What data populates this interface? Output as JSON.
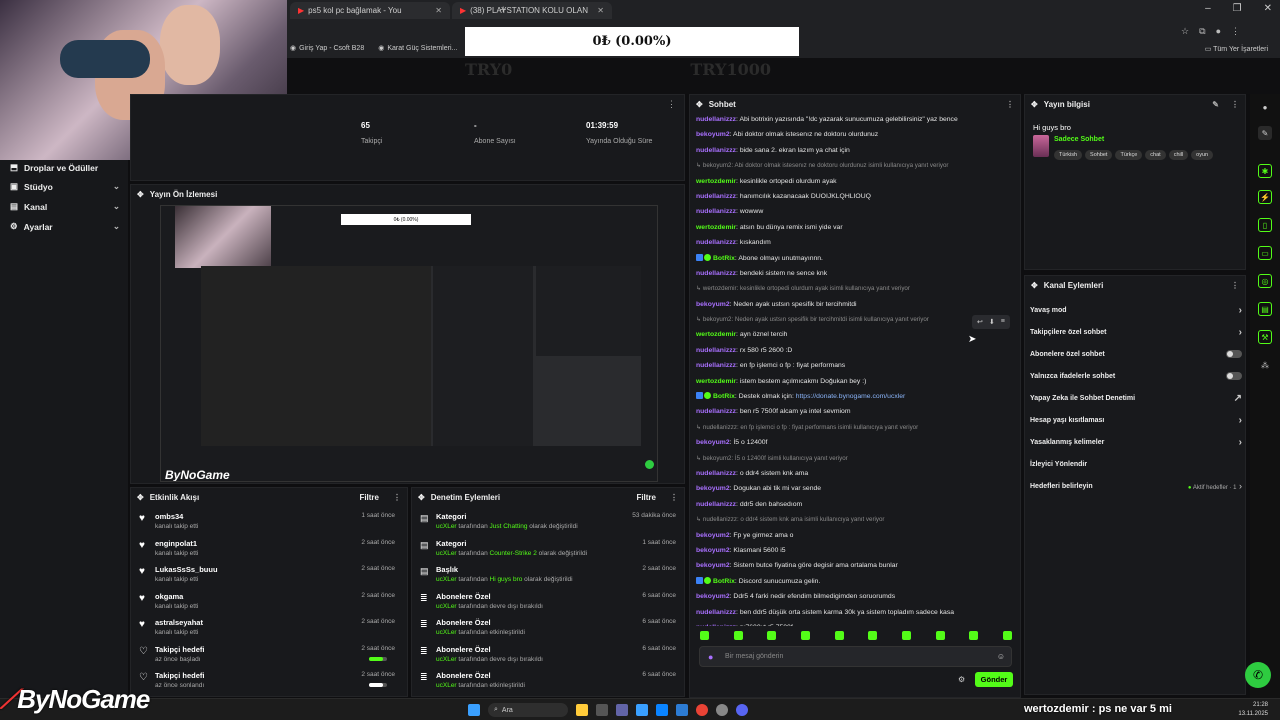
{
  "browser": {
    "tabs": [
      {
        "label": "ps5 kol pc bağlamak - You",
        "icon": "youtube-icon"
      },
      {
        "label": "(38) PLAYSTATION KOLU OLAN",
        "icon": "youtube-icon"
      }
    ],
    "bookmarks": [
      "Giriş Yap - Csoft B28",
      "Karat Güç Sistemleri..."
    ],
    "all_bookmarks": "Tüm Yer İşaretleri"
  },
  "overlay": {
    "donation": "0₺ (0.00%)",
    "try_left": "TRY0",
    "try_right": "TRY1000",
    "logo": "ByNoGame",
    "chat_line": "wertozdemir : ps ne var 5 mi"
  },
  "leftnav": {
    "items": [
      {
        "label": "Droplar ve Ödüller",
        "chev": ""
      },
      {
        "label": "Stüdyo",
        "chev": "⌄"
      },
      {
        "label": "Kanal",
        "chev": "⌄"
      },
      {
        "label": "Ayarlar",
        "chev": "⌄"
      }
    ]
  },
  "stats": {
    "followers_value": "65",
    "followers_label": "Takipçi",
    "subs_value": "-",
    "subs_label": "Abone Sayısı",
    "uptime_value": "01:39:59",
    "uptime_label": "Yayında Olduğu Süre"
  },
  "preview": {
    "title": "Yayın Ön İzlemesi",
    "inner_donation": "0₺ (0.00%)",
    "logo": "ByNoGame"
  },
  "activity": {
    "title": "Etkinlik Akışı",
    "filter": "Filtre",
    "items": [
      {
        "name": "ombs34",
        "desc": "kanalı takip etti",
        "time": "1 saat önce"
      },
      {
        "name": "enginpolat1",
        "desc": "kanalı takip etti",
        "time": "2 saat önce"
      },
      {
        "name": "LukasSsSs_buuu",
        "desc": "kanalı takip etti",
        "time": "2 saat önce"
      },
      {
        "name": "okgama",
        "desc": "kanalı takip etti",
        "time": "2 saat önce"
      },
      {
        "name": "astralseyahat",
        "desc": "kanalı takip etti",
        "time": "2 saat önce"
      },
      {
        "name": "Takipçi hedefi",
        "desc": "az önce başladı",
        "time": "2 saat önce",
        "progress": 0.8,
        "color": "#53fc18"
      },
      {
        "name": "Takipçi hedefi",
        "desc": "az önce sonlandı",
        "time": "2 saat önce",
        "progress": 0.8,
        "color": "#ffffff"
      }
    ]
  },
  "moderation": {
    "title": "Denetim Eylemleri",
    "filter": "Filtre",
    "items": [
      {
        "name": "Kategori",
        "user": "ucXLer",
        "pre": " tarafından ",
        "hl": "Just Chatting",
        "post": " olarak değiştirildi",
        "time": "53 dakika önce"
      },
      {
        "name": "Kategori",
        "user": "ucXLer",
        "pre": " tarafından ",
        "hl": "Counter-Strike 2",
        "post": " olarak değiştirildi",
        "time": "1 saat önce"
      },
      {
        "name": "Başlık",
        "user": "ucXLer",
        "pre": " tarafından ",
        "hl": "Hi guys bro",
        "post": " olarak değiştirildi",
        "time": "2 saat önce"
      },
      {
        "name": "Abonelere Özel",
        "user": "ucXLer",
        "pre": " tarafından devre dışı bırakıldı",
        "hl": "",
        "post": "",
        "time": "6 saat önce"
      },
      {
        "name": "Abonelere Özel",
        "user": "ucXLer",
        "pre": " tarafından etkinleştirildi",
        "hl": "",
        "post": "",
        "time": "6 saat önce"
      },
      {
        "name": "Abonelere Özel",
        "user": "ucXLer",
        "pre": " tarafından devre dışı bırakıldı",
        "hl": "",
        "post": "",
        "time": "6 saat önce"
      },
      {
        "name": "Abonelere Özel",
        "user": "ucXLer",
        "pre": " tarafından etkinleştirildi",
        "hl": "",
        "post": "",
        "time": "6 saat önce"
      }
    ]
  },
  "chat": {
    "title": "Sohbet",
    "placeholder": "Bir mesaj gönderin",
    "send": "Gönder",
    "messages": [
      {
        "u": "nudellanizzz",
        "c": "#a970ff",
        "t": "Abi botrixin yazısında \"!dc yazarak sunucumuza gelebilirsiniz\" yaz bence"
      },
      {
        "u": "bekoyum2",
        "c": "#a970ff",
        "t": "Abi doktor olmak istesenız ne doktoru olurdunuz"
      },
      {
        "u": "nudellanizzz",
        "c": "#a970ff",
        "t": "bide sana 2. ekran lazım ya chat için"
      },
      {
        "reply": "bekoyum2: Abi doktor olmak istesenız ne doktoru olurdunuz isimli kullanıcıya yanıt veriyor"
      },
      {
        "u": "wertozdemir",
        "c": "#53fc18",
        "t": "kesinlikle ortopedi olurdum ayak"
      },
      {
        "u": "nudellanizzz",
        "c": "#a970ff",
        "t": "hanımcılık kazanacaak DUOIJKLQHLIOUQ"
      },
      {
        "u": "nudellanizzz",
        "c": "#a970ff",
        "t": "wowww"
      },
      {
        "u": "wertozdemir",
        "c": "#53fc18",
        "t": "atsın bu dünya remix ismi yide var"
      },
      {
        "u": "nudellanizzz",
        "c": "#a970ff",
        "t": "kıskandım"
      },
      {
        "u": "BotRix",
        "c": "#53fc18",
        "t": "Abone olmayı unutmayınnn.",
        "bot": true
      },
      {
        "u": "nudellanizzz",
        "c": "#a970ff",
        "t": "bendeki sistem ne sence knk"
      },
      {
        "reply": "wertozdemir: kesinlikle ortopedi olurdum ayak isimli kullanıcıya yanıt veriyor"
      },
      {
        "u": "bekoyum2",
        "c": "#a970ff",
        "t": "Neden ayak ustsın spesifik bir tercihmitdi"
      },
      {
        "reply": "bekoyum2: Neden ayak ustsın spesifik bir tercihmitdi isimli kullanıcıya yanıt veriyor"
      },
      {
        "u": "wertozdemir",
        "c": "#53fc18",
        "t": "ayn öznel tercih"
      },
      {
        "u": "nudellanizzz",
        "c": "#a970ff",
        "t": "rx 580 r5 2600 :D"
      },
      {
        "u": "nudellanizzz",
        "c": "#a970ff",
        "t": "en fp işlemci o fp : fiyat performans"
      },
      {
        "u": "wertozdemir",
        "c": "#53fc18",
        "t": "istem bestem açılmıcakmı Doğukan bey :)"
      },
      {
        "u": "BotRix",
        "c": "#53fc18",
        "t": "Destek olmak için: ",
        "link": "https://donate.bynogame.com/ucxler",
        "bot": true
      },
      {
        "u": "nudellanizzz",
        "c": "#a970ff",
        "t": "ben r5 7500f alcam ya intel sevmiom"
      },
      {
        "reply": "nudellanizzz: en fp işlemci o fp : fiyat performans isimli kullanıcıya yanıt veriyor"
      },
      {
        "u": "bekoyum2",
        "c": "#a970ff",
        "t": "İ5 o 12400f"
      },
      {
        "reply": "bekoyum2: İ5 o 12400f isimli kullanıcıya yanıt veriyor"
      },
      {
        "u": "nudellanizzz",
        "c": "#a970ff",
        "t": "o ddr4 sistem knk ama"
      },
      {
        "u": "bekoyum2",
        "c": "#a970ff",
        "t": "Dogukan abi tik mi var sende"
      },
      {
        "u": "nudellanizzz",
        "c": "#a970ff",
        "t": "ddr5 den bahsedıom"
      },
      {
        "reply": "nudellanizzz: o ddr4 sistem knk ama isimli kullanıcıya yanıt veriyor"
      },
      {
        "u": "bekoyum2",
        "c": "#a970ff",
        "t": "Fp ye girmez ama o"
      },
      {
        "u": "bekoyum2",
        "c": "#a970ff",
        "t": "Klasmani 5600 i5"
      },
      {
        "u": "bekoyum2",
        "c": "#a970ff",
        "t": "Sistem butce fiyatina göre degisir ama ortalama bunlar"
      },
      {
        "u": "BotRix",
        "c": "#53fc18",
        "t": "Discord sunucumuza gelin.",
        "bot": true
      },
      {
        "u": "bekoyum2",
        "c": "#a970ff",
        "t": "Ddr5 4 farki nedir efendim bilmedigimden soruorumds"
      },
      {
        "u": "nudellanizzz",
        "c": "#a970ff",
        "t": "ben ddr5 düşük orta sistem karma 30k ya sistem topladım sadece kasa"
      },
      {
        "u": "nudellanizzz",
        "c": "#a970ff",
        "t": "rx7600xt r5 7500f"
      },
      {
        "u": "bekoyum2",
        "c": "#a970ff",
        "t": "Dogukan abi kol varsa abla ile ortak oynanabilecek cok iyi oyunlar var bir ara oynasanıza"
      },
      {
        "u": "wertozdemir",
        "c": "#53fc18",
        "t": "ps ne var 5 mi"
      }
    ]
  },
  "info": {
    "title": "Yayın bilgisi",
    "stream_title": "Hi guys bro",
    "category": "Sadece Sohbet",
    "tags": [
      "Türkish",
      "Sohbet",
      "Türkçe",
      "chat",
      "chill",
      "oyun"
    ]
  },
  "actions": {
    "title": "Kanal Eylemleri",
    "items": [
      {
        "label": "Yavaş mod",
        "right": "›"
      },
      {
        "label": "Takipçilere özel sohbet",
        "right": "›"
      },
      {
        "label": "Abonelere özel sohbet",
        "right": "toggle"
      },
      {
        "label": "Yalnızca ifadelerle sohbet",
        "right": "toggle"
      },
      {
        "label": "Yapay Zeka ile Sohbet Denetimi",
        "right": "↗"
      },
      {
        "label": "Hesap yaşı kısıtlaması",
        "right": "›"
      },
      {
        "label": "Yasaklanmış kelimeler",
        "right": "›"
      },
      {
        "label": "İzleyici Yönlendir",
        "right": ""
      },
      {
        "label": "Hedefleri belirleyin",
        "right": "goal"
      }
    ],
    "goal_text": "Aktif hedefler · 1"
  },
  "taskbar": {
    "search": "Ara",
    "time": "21:28",
    "date": "13.11.2025"
  },
  "colors": {
    "accent": "#53fc18",
    "purple": "#a970ff",
    "bg": "#0e0e10"
  }
}
